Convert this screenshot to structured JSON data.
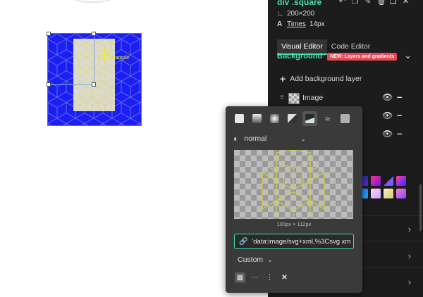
{
  "selection": {
    "name": "div .square",
    "size_text": "200×200",
    "font_link": "Times",
    "font_size": "14px"
  },
  "canvas": {
    "example_text_big": "E",
    "example_text_small": "xample"
  },
  "panel": {
    "tabs": [
      {
        "label": "Visual Editor",
        "active": true
      },
      {
        "label": "Code Editor",
        "active": false
      }
    ],
    "background_title": "Background",
    "background_badge": "NEW: Layers and gradients",
    "add_layer_label": "Add background layer",
    "layers": [
      {
        "label": "Image"
      }
    ]
  },
  "popup": {
    "blend_mode": "normal",
    "preview_size": "100px × 112px",
    "url_value": "'data:image/svg+xml,%3Csvg xmlns",
    "size_mode": "Custom"
  },
  "colors": {
    "accent": "#44e0a5",
    "badge": "#e84855",
    "canvas_square": "#1d1ef5",
    "pattern_line": "#e6e63a"
  },
  "icons": {
    "toolbar": [
      "undo-icon",
      "copy-icon",
      "edit-icon",
      "delete-icon",
      "duplicate-icon",
      "close-icon"
    ],
    "type_buttons": [
      "solid-color-icon",
      "linear-gradient-icon",
      "radial-gradient-icon",
      "conic-gradient-icon",
      "image-icon",
      "pattern-icon",
      "noise-icon"
    ],
    "repeat_buttons": [
      "grid-icon",
      "dots-icon",
      "more-vertical-icon",
      "close-icon"
    ]
  }
}
